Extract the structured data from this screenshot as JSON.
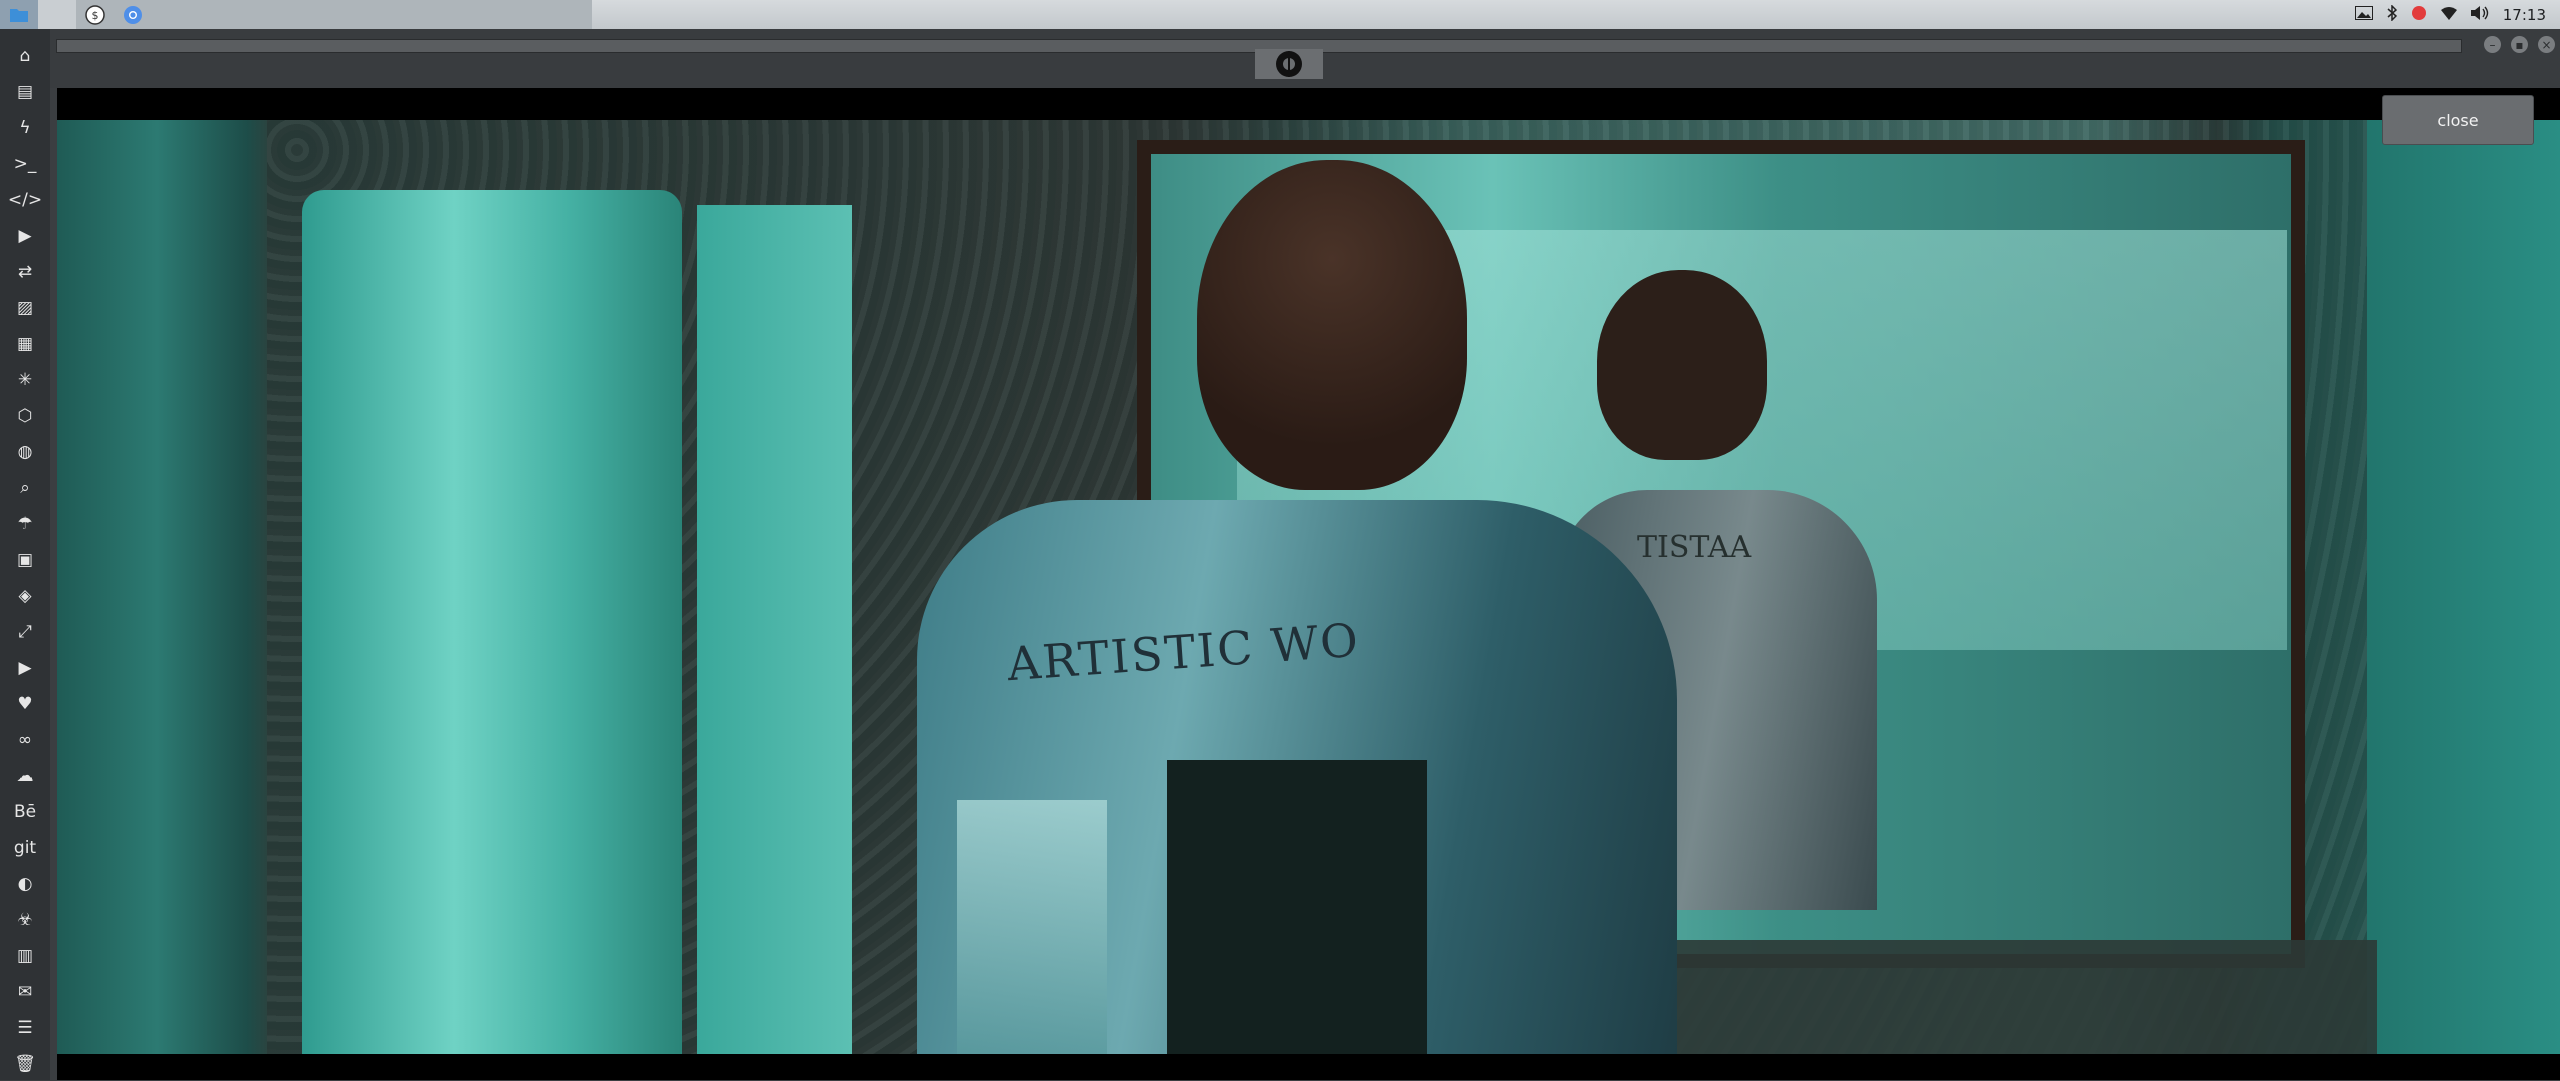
{
  "taskbar": {
    "apps": [
      {
        "name": "files-app-icon",
        "active": true
      },
      {
        "name": "blank-app",
        "active": false
      },
      {
        "name": "dollar-app-icon",
        "active": false,
        "glyph": "$"
      },
      {
        "name": "chrome-app-icon",
        "active": false
      }
    ],
    "tray": {
      "icons": [
        "image-icon",
        "bluetooth-icon",
        "record-icon",
        "wifi-icon",
        "volume-icon"
      ],
      "clock": "17:13"
    }
  },
  "dock": {
    "items": [
      {
        "name": "home-icon",
        "glyph": "⌂"
      },
      {
        "name": "document-icon",
        "glyph": "▤"
      },
      {
        "name": "bolt-icon",
        "glyph": "ϟ"
      },
      {
        "name": "terminal-icon",
        "glyph": ">_"
      },
      {
        "name": "code-icon",
        "glyph": "</>"
      },
      {
        "name": "play-icon",
        "glyph": "▶"
      },
      {
        "name": "translate-icon",
        "glyph": "⇄"
      },
      {
        "name": "image-icon",
        "glyph": "▨"
      },
      {
        "name": "news-icon",
        "glyph": "▦"
      },
      {
        "name": "react-icon",
        "glyph": "✳"
      },
      {
        "name": "hexagon-icon",
        "glyph": "⬡"
      },
      {
        "name": "globe-icon",
        "glyph": "◍"
      },
      {
        "name": "search-icon",
        "glyph": "⌕"
      },
      {
        "name": "umbrella-icon",
        "glyph": "☂"
      },
      {
        "name": "contact-icon",
        "glyph": "▣"
      },
      {
        "name": "tag-icon",
        "glyph": "◈"
      },
      {
        "name": "expand-icon",
        "glyph": "⤢"
      },
      {
        "name": "youtube-icon",
        "glyph": "▶"
      },
      {
        "name": "heart-icon",
        "glyph": "♥"
      },
      {
        "name": "infinity-icon",
        "glyph": "∞"
      },
      {
        "name": "cloud-icon",
        "glyph": "☁"
      },
      {
        "name": "behance-icon",
        "glyph": "Bē"
      },
      {
        "name": "git-icon",
        "glyph": "git"
      },
      {
        "name": "github-icon",
        "glyph": "◐"
      },
      {
        "name": "biohazard-icon",
        "glyph": "☣"
      },
      {
        "name": "map-icon",
        "glyph": "▥"
      },
      {
        "name": "mail-icon",
        "glyph": "✉"
      },
      {
        "name": "server-icon",
        "glyph": "☰"
      },
      {
        "name": "trash-icon",
        "glyph": "🗑"
      }
    ]
  },
  "window": {
    "controls": [
      "minimize-icon",
      "maximize-icon",
      "close-icon"
    ],
    "logo": "rebel-alliance-logo"
  },
  "video": {
    "close_label": "close",
    "jacket_text": "ARTISTIC WO",
    "reflection_text": "TISTAA"
  }
}
